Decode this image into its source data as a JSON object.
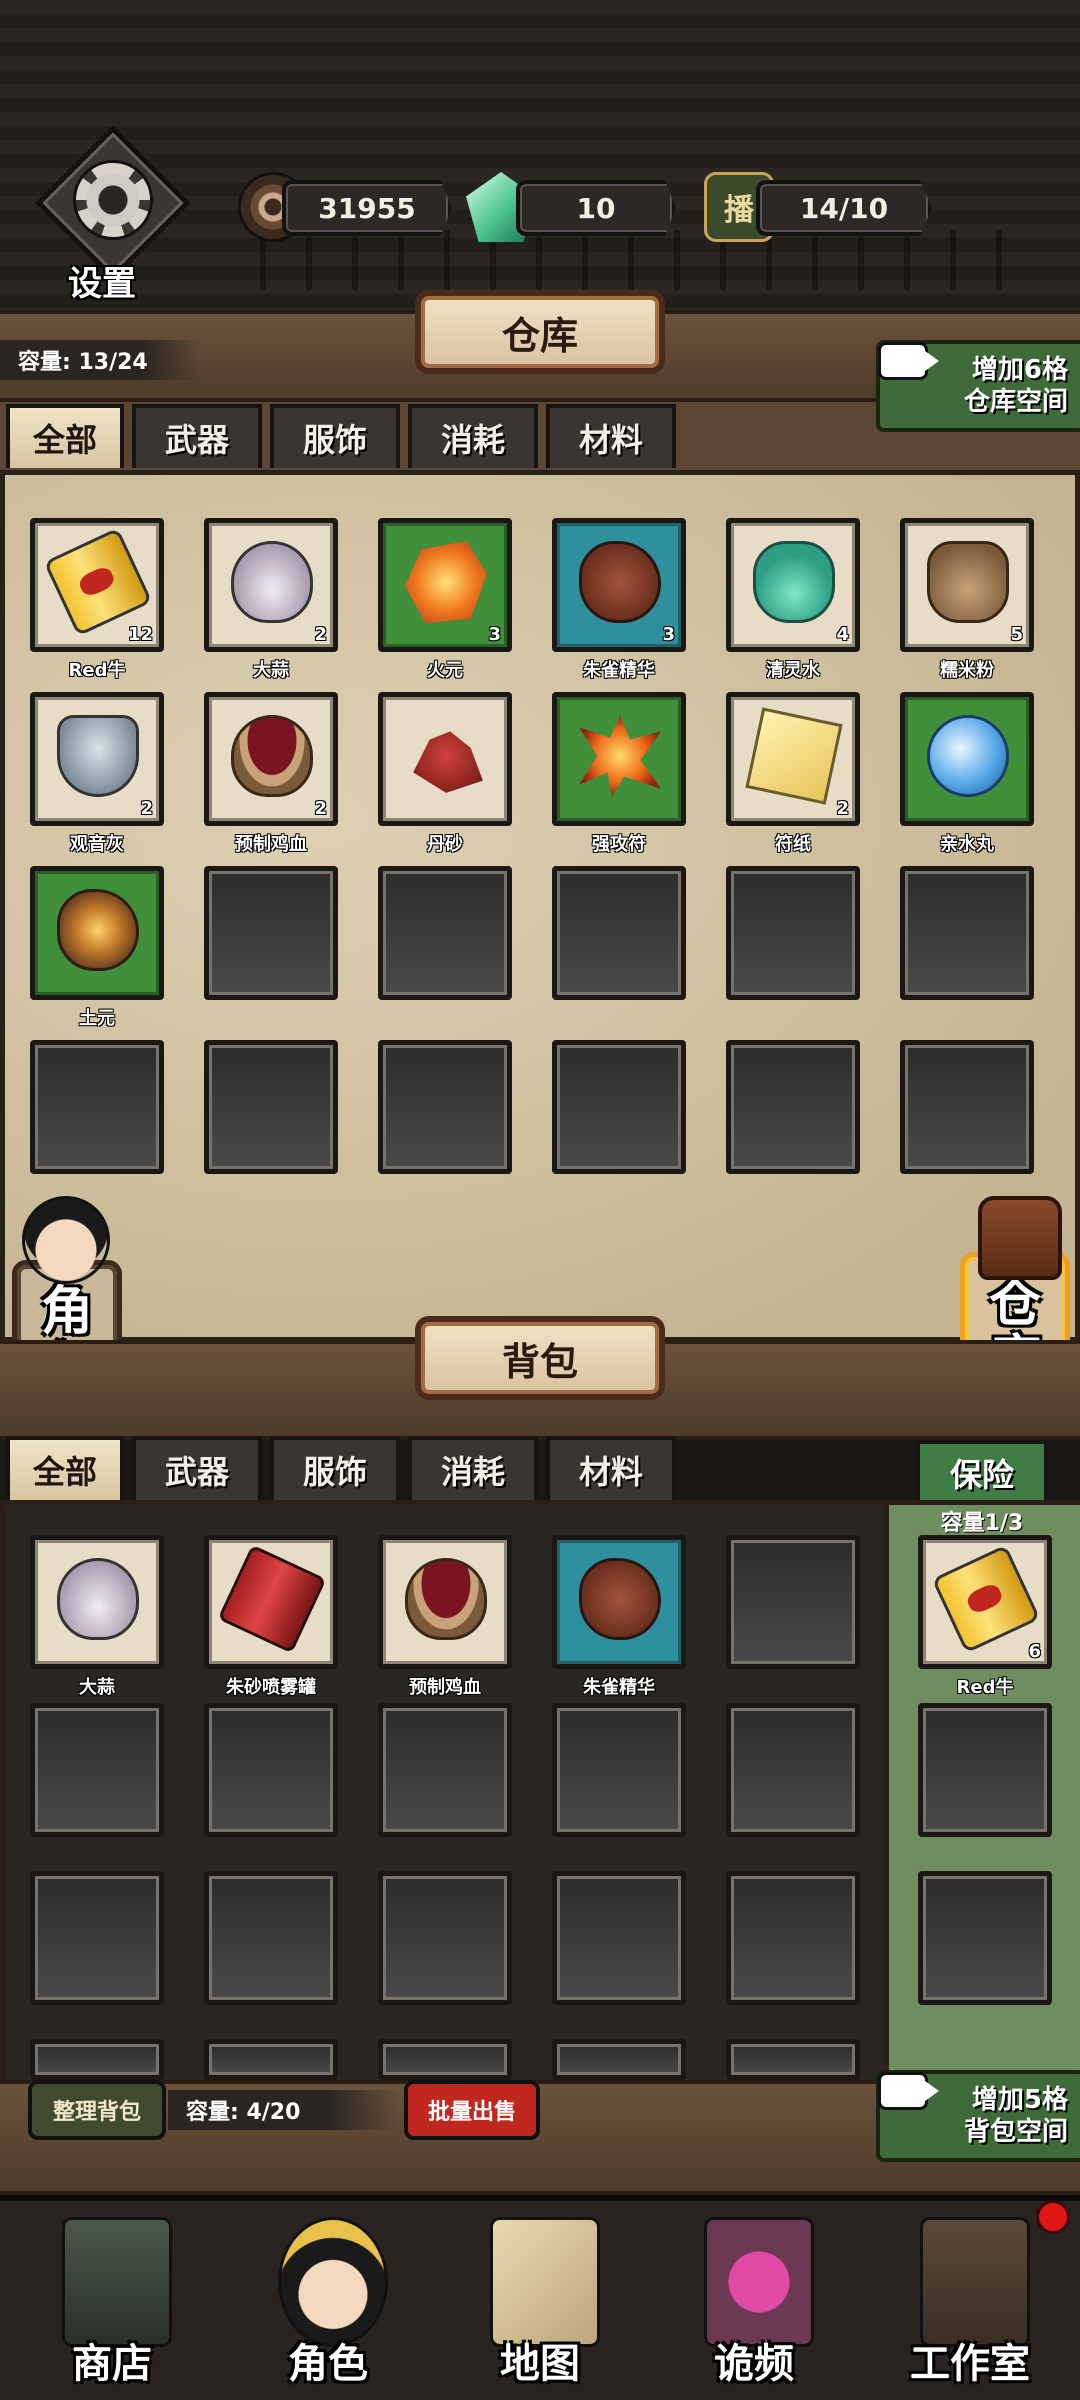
{
  "header": {
    "settings_label": "设置",
    "coins": "31955",
    "gems": "10",
    "ticket_icon_char": "播",
    "tickets": "14/10"
  },
  "warehouse": {
    "title": "仓库",
    "capacity": "容量: 13/24",
    "expand_line1": "增加6格",
    "expand_line2": "仓库空间",
    "tabs": [
      "全部",
      "武器",
      "服饰",
      "消耗",
      "材料"
    ],
    "items": [
      {
        "name": "Red牛",
        "qty": "12",
        "rarity": "common",
        "icon": "can-icon"
      },
      {
        "name": "大蒜",
        "qty": "2",
        "rarity": "common",
        "icon": "garlic-icon"
      },
      {
        "name": "火元",
        "qty": "3",
        "rarity": "green",
        "icon": "fire-crystal-icon"
      },
      {
        "name": "朱雀精华",
        "qty": "3",
        "rarity": "blue",
        "icon": "walnut-icon"
      },
      {
        "name": "清灵水",
        "qty": "4",
        "rarity": "common",
        "icon": "potion-bottle-icon"
      },
      {
        "name": "糯米粉",
        "qty": "5",
        "rarity": "common",
        "icon": "flour-sack-icon"
      },
      {
        "name": "观音灰",
        "qty": "2",
        "rarity": "common",
        "icon": "incense-urn-icon"
      },
      {
        "name": "预制鸡血",
        "qty": "2",
        "rarity": "common",
        "icon": "blood-bowl-icon"
      },
      {
        "name": "丹砂",
        "qty": "",
        "rarity": "common",
        "icon": "cinnabar-icon"
      },
      {
        "name": "强攻符",
        "qty": "",
        "rarity": "green",
        "icon": "talisman-icon"
      },
      {
        "name": "符纸",
        "qty": "2",
        "rarity": "common",
        "icon": "paper-icon"
      },
      {
        "name": "亲水丸",
        "qty": "",
        "rarity": "green",
        "icon": "water-orb-icon"
      },
      {
        "name": "土元",
        "qty": "",
        "rarity": "green",
        "icon": "earth-crystal-icon"
      }
    ]
  },
  "side_buttons": {
    "character": "角色",
    "warehouse": "仓库"
  },
  "backpack": {
    "title": "背包",
    "tabs": [
      "全部",
      "武器",
      "服饰",
      "消耗",
      "材料"
    ],
    "safe_tab": "保险",
    "safe_capacity": "容量1/3",
    "items": [
      {
        "name": "大蒜",
        "qty": "",
        "rarity": "common",
        "icon": "garlic-icon"
      },
      {
        "name": "朱砂喷雾罐",
        "qty": "",
        "rarity": "common",
        "icon": "spray-can-icon"
      },
      {
        "name": "预制鸡血",
        "qty": "",
        "rarity": "common",
        "icon": "blood-bowl-icon"
      },
      {
        "name": "朱雀精华",
        "qty": "",
        "rarity": "blue",
        "icon": "walnut-icon"
      }
    ],
    "safe_items": [
      {
        "name": "Red牛",
        "qty": "6",
        "rarity": "common",
        "icon": "can-icon"
      }
    ],
    "sort_button": "整理背包",
    "capacity": "容量: 4/20",
    "batch_sell": "批量出售",
    "expand_line1": "增加5格",
    "expand_line2": "背包空间"
  },
  "nav": [
    "商店",
    "角色",
    "地图",
    "诡频",
    "工作室"
  ],
  "colors": {
    "accent_green": "#3f6b3a",
    "sell_red": "#c0281f",
    "highlight_gold": "#f0a11a"
  }
}
